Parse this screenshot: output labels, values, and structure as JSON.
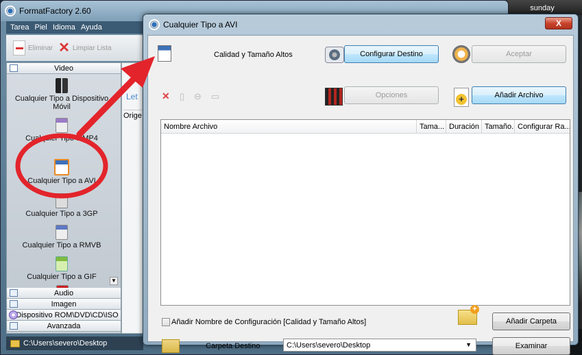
{
  "desktop": {
    "clock_text": "sunday"
  },
  "main_window": {
    "title": "FormatFactory 2.60",
    "menu": [
      "Tarea",
      "Piel",
      "Idioma",
      "Ayuda"
    ],
    "toolbar": {
      "delete_label": "Eliminar",
      "clear_label": "Limpiar Lista"
    },
    "categories": {
      "video_header": "Video",
      "video_items": [
        "Cualquier Tipo a Dispositivo Móvil",
        "Cualquier Tipo a MP4",
        "Cualquier Tipo a AVI",
        "Cualquier Tipo a 3GP",
        "Cualquier Tipo a RMVB",
        "Cualquier Tipo a GIF"
      ],
      "other": [
        "Audio",
        "Imagen",
        "Dispositivo ROM\\DVD\\CD\\ISO",
        "Avanzada"
      ]
    },
    "mid_strip": {
      "tab_partial": "Let",
      "col_partial": "Orige"
    },
    "status_path": "C:\\Users\\severo\\Desktop"
  },
  "dialog": {
    "title": "Cualquier Tipo a AVI",
    "close_label": "X",
    "quality_label": "Calidad y Tamaño Altos",
    "buttons": {
      "config_dest": "Configurar Destino",
      "accept": "Aceptar",
      "options": "Opciones",
      "add_file": "Añadir Archivo",
      "add_folder": "Añadir Carpeta",
      "browse": "Examinar"
    },
    "table_columns": [
      "Nombre Archivo",
      "Tama...",
      "Duración",
      "Tamaño...",
      "Configurar Ra..."
    ],
    "config_checkbox_label": "Añadir Nombre de Configuración [Calidad y Tamaño Altos]",
    "dest_label": "Carpeta Destino",
    "dest_value": "C:\\Users\\severo\\Desktop"
  },
  "colors": {
    "annotation_red": "#e3242b",
    "accent_blue": "#3c7fb1"
  }
}
